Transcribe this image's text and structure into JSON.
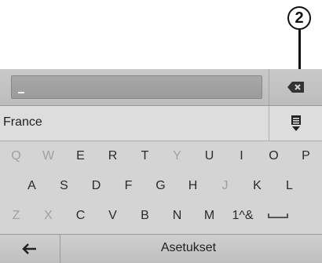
{
  "callout": {
    "number": "2"
  },
  "search": {
    "value": ""
  },
  "result": {
    "label": "France"
  },
  "keyboard": {
    "row1": [
      {
        "label": "Q",
        "enabled": false
      },
      {
        "label": "W",
        "enabled": false
      },
      {
        "label": "E",
        "enabled": true
      },
      {
        "label": "R",
        "enabled": true
      },
      {
        "label": "T",
        "enabled": true
      },
      {
        "label": "Y",
        "enabled": false
      },
      {
        "label": "U",
        "enabled": true
      },
      {
        "label": "I",
        "enabled": true
      },
      {
        "label": "O",
        "enabled": true
      },
      {
        "label": "P",
        "enabled": true
      }
    ],
    "row2": [
      {
        "label": "A",
        "enabled": true
      },
      {
        "label": "S",
        "enabled": true
      },
      {
        "label": "D",
        "enabled": true
      },
      {
        "label": "F",
        "enabled": true
      },
      {
        "label": "G",
        "enabled": true
      },
      {
        "label": "H",
        "enabled": true
      },
      {
        "label": "J",
        "enabled": false
      },
      {
        "label": "K",
        "enabled": true
      },
      {
        "label": "L",
        "enabled": true
      }
    ],
    "row3": [
      {
        "label": "Z",
        "enabled": false
      },
      {
        "label": "X",
        "enabled": false
      },
      {
        "label": "C",
        "enabled": true
      },
      {
        "label": "V",
        "enabled": true
      },
      {
        "label": "B",
        "enabled": true
      },
      {
        "label": "N",
        "enabled": true
      },
      {
        "label": "M",
        "enabled": true
      },
      {
        "label": "1^&",
        "enabled": true
      },
      {
        "label": "␣",
        "enabled": true,
        "icon": "space-icon"
      }
    ]
  },
  "bottom": {
    "back_icon": "back-arrow-icon",
    "settings_label": "Asetukset"
  },
  "icons": {
    "backspace": "backspace-icon",
    "list": "list-icon"
  }
}
